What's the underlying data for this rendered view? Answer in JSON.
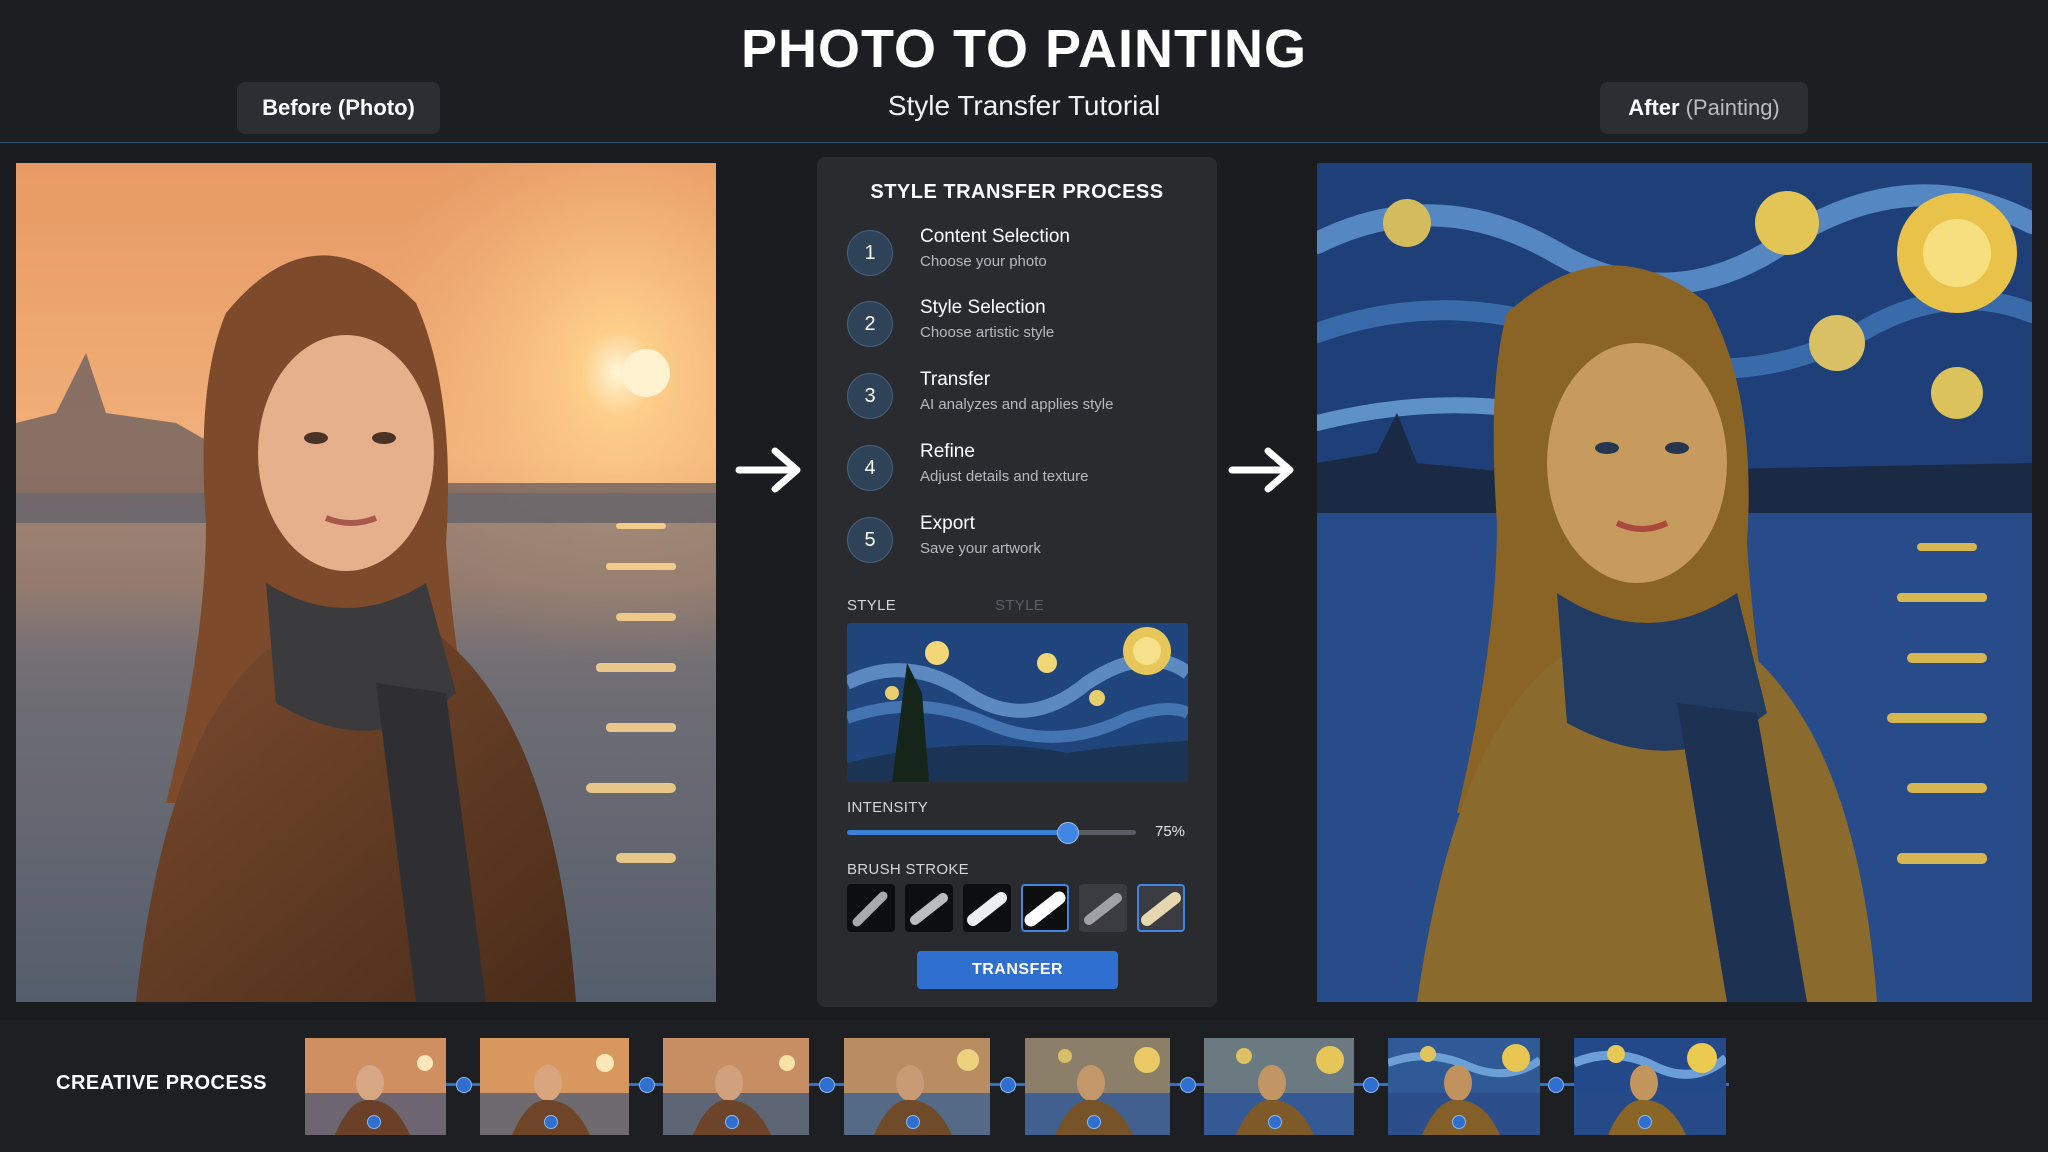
{
  "header": {
    "title": "PHOTO TO PAINTING",
    "subtitle": "Style Transfer Tutorial",
    "before_label": "Before (Photo)",
    "after_label_main": "After",
    "after_label_muted": "(Painting)"
  },
  "panel": {
    "title": "STYLE TRANSFER PROCESS",
    "steps": [
      {
        "num": "1",
        "title": "Content Selection",
        "sub": "Choose your photo"
      },
      {
        "num": "2",
        "title": "Style Selection",
        "sub": "Choose artistic style"
      },
      {
        "num": "3",
        "title": "Transfer",
        "sub": "AI analyzes and applies style"
      },
      {
        "num": "4",
        "title": "Refine",
        "sub": "Adjust details and texture"
      },
      {
        "num": "5",
        "title": "Export",
        "sub": "Save your artwork"
      }
    ],
    "style_label": "STYLE",
    "style_label_faint": "STYLE",
    "intensity_label": "INTENSITY",
    "intensity_value": "75%",
    "intensity_fraction": 0.76,
    "brush_label": "BRUSH STROKE",
    "brush_selected": [
      3,
      5
    ],
    "transfer_button": "TRANSFER"
  },
  "footer": {
    "label": "CREATIVE PROCESS"
  },
  "colors": {
    "accent": "#2f6fd0",
    "background": "#1b1c1f",
    "panel": "#2a2b2f"
  }
}
